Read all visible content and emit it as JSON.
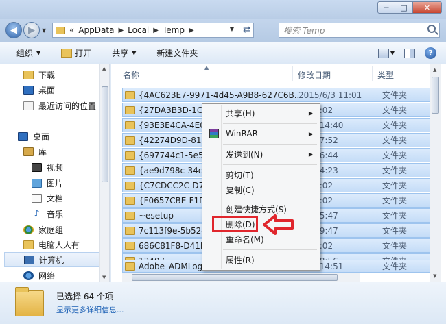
{
  "window": {
    "min": "─",
    "max": "□",
    "close": "✕"
  },
  "address": {
    "overflow": "«",
    "crumbs": [
      "AppData",
      "Local",
      "Temp"
    ],
    "search_placeholder": "搜索 Temp"
  },
  "toolbar": {
    "organize": "组织",
    "open": "打开",
    "share": "共享",
    "new_folder": "新建文件夹"
  },
  "nav": {
    "items": [
      {
        "label": "下载",
        "icon": "download-folder-icon"
      },
      {
        "label": "桌面",
        "icon": "desktop-icon"
      },
      {
        "label": "最近访问的位置",
        "icon": "recent-places-icon"
      },
      {
        "label": "桌面",
        "icon": "desktop-icon"
      },
      {
        "label": "库",
        "icon": "library-icon"
      },
      {
        "label": "视频",
        "icon": "video-icon"
      },
      {
        "label": "图片",
        "icon": "pictures-icon"
      },
      {
        "label": "文档",
        "icon": "documents-icon"
      },
      {
        "label": "音乐",
        "icon": "music-icon"
      },
      {
        "label": "家庭组",
        "icon": "homegroup-icon"
      },
      {
        "label": "电脑人人有",
        "icon": "user-folder-icon"
      },
      {
        "label": "计算机",
        "icon": "computer-icon"
      },
      {
        "label": "网络",
        "icon": "network-icon"
      }
    ]
  },
  "columns": {
    "name": "名称",
    "date": "修改日期",
    "type": "类型"
  },
  "files": [
    {
      "name": "{4AC623E7-9971-4d45-A9B8-627C6B...",
      "date": "2015/6/3 11:01",
      "type": "文件夹"
    },
    {
      "name": "{27DA3B3D-1C4",
      "date": "6/4 5:02",
      "type": "文件夹"
    },
    {
      "name": "{93E3E4CA-4E07",
      "date": "5/27 14:40",
      "type": "文件夹"
    },
    {
      "name": "{42274D9D-8180",
      "date": "4/22 7:52",
      "type": "文件夹"
    },
    {
      "name": "{697744c1-5e5f-",
      "date": "4/5 16:44",
      "type": "文件夹"
    },
    {
      "name": "{ae9d798c-34c9-",
      "date": "5/9 14:23",
      "type": "文件夹"
    },
    {
      "name": "{C7CDCC2C-D70",
      "date": "6/4 5:02",
      "type": "文件夹"
    },
    {
      "name": "{F0657CBE-F1DD",
      "date": "6/4 5:02",
      "type": "文件夹"
    },
    {
      "name": "~esetup",
      "date": "5/9 15:47",
      "type": "文件夹"
    },
    {
      "name": "7c113f9e-5b52-4",
      "date": "6/5 19:47",
      "type": "文件夹"
    },
    {
      "name": "686C81F8-D41E-",
      "date": "6/4 5:02",
      "type": "文件夹"
    },
    {
      "name": "13407",
      "date": "5/26 8:56",
      "type": "文件夹"
    },
    {
      "name": "Adobe_ADMLog",
      "date": "5/13 14:51",
      "type": "文件夹"
    }
  ],
  "context_menu": {
    "share": "共享(H)",
    "winrar": "WinRAR",
    "send_to": "发送到(N)",
    "cut": "剪切(T)",
    "copy": "复制(C)",
    "create_shortcut": "创建快捷方式(S)",
    "delete": "删除(D)",
    "rename": "重命名(M)",
    "properties": "属性(R)"
  },
  "details": {
    "selected": "已选择 64 个项",
    "more": "显示更多详细信息..."
  },
  "colors": {
    "selection": "#c4dcf7",
    "highlight_red": "#e0262d"
  }
}
